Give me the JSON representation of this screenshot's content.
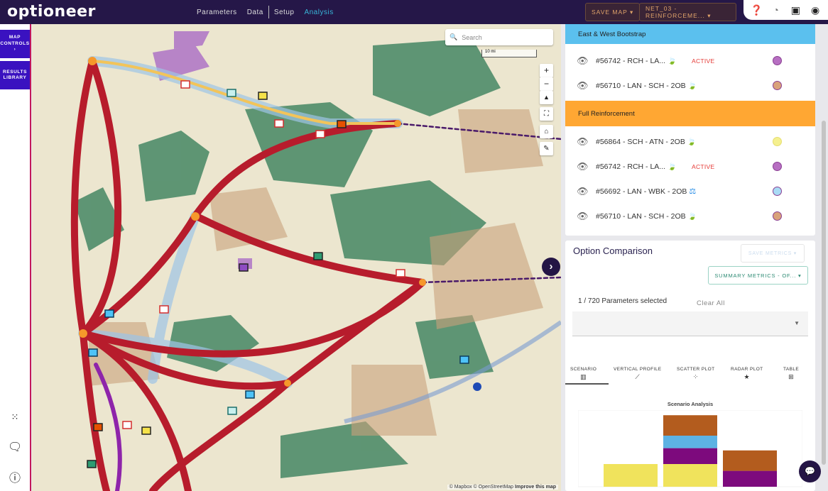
{
  "app": {
    "logo": "optioneer"
  },
  "nav": {
    "items": [
      {
        "label": "Parameters"
      },
      {
        "label": "Data"
      },
      {
        "label": "Setup"
      },
      {
        "label": "Analysis",
        "active": true
      }
    ]
  },
  "toolbar": {
    "save_map": "SAVE MAP ▾",
    "network": "NET_03 - REINFORCEME... ▾",
    "icons": [
      "help-icon",
      "speedometer-icon",
      "feedback-icon",
      "account-icon"
    ]
  },
  "sidebar": {
    "map_controls": "MAP CONTROLS ›",
    "results_library": "RESULTS LIBRARY",
    "icons": [
      "grid-dots-icon",
      "comment-icon",
      "info-icon"
    ]
  },
  "map": {
    "search_placeholder": "Search",
    "scale": "10 mi",
    "attribution": "© Mapbox © OpenStreetMap",
    "improve": "Improve this map"
  },
  "groups": [
    {
      "title": "East & West Bootstrap",
      "color": "#5bc0ee",
      "items": [
        {
          "label": "#56742 - RCH - LA...",
          "icon": "leaf",
          "status": "ACTIVE",
          "dot": "#b76fc2"
        },
        {
          "label": "#56710 - LAN - SCH - 2OB",
          "icon": "leaf",
          "status": "",
          "dot": "#d9a27a"
        }
      ]
    },
    {
      "title": "Full Reinforcement",
      "color": "#ffa733",
      "items": [
        {
          "label": "#56864 - SCH - ATN - 2OB",
          "icon": "leaf",
          "status": "",
          "dot": "#f5f08f"
        },
        {
          "label": "#56742 - RCH - LA...",
          "icon": "leaf",
          "status": "ACTIVE",
          "dot": "#b76fc2"
        },
        {
          "label": "#56692 - LAN - WBK - 2OB",
          "icon": "scale",
          "status": "",
          "dot": "#a9dbf5"
        },
        {
          "label": "#56710 - LAN - SCH - 2OB",
          "icon": "leaf",
          "status": "",
          "dot": "#d9a27a"
        }
      ]
    }
  ],
  "comparison": {
    "title": "Option Comparison",
    "save_metrics": "SAVE METRICS ▾",
    "summary_metrics": "SUMMARY METRICS - OF... ▾",
    "selected": "1 / 720 Parameters selected",
    "clear_all": "Clear All",
    "tabs": [
      {
        "label": "SCENARIO",
        "icon": "bar-chart-icon",
        "glyph": "▥",
        "active": true
      },
      {
        "label": "VERTICAL PROFILE",
        "icon": "line-chart-icon",
        "glyph": "⟋"
      },
      {
        "label": "SCATTER PLOT",
        "icon": "scatter-icon",
        "glyph": "⁘"
      },
      {
        "label": "RADAR PLOT",
        "icon": "star-icon",
        "glyph": "★"
      },
      {
        "label": "TABLE",
        "icon": "table-icon",
        "glyph": "⊞"
      }
    ]
  },
  "chart_data": {
    "type": "bar",
    "stacked": true,
    "title": "Scenario Analysis",
    "categories": [
      "",
      "",
      ""
    ],
    "series": [
      {
        "color": "#f0e35c",
        "values": [
          1.0,
          1.0,
          0
        ]
      },
      {
        "color": "#7d0a7d",
        "values": [
          0,
          0.7,
          0.7
        ]
      },
      {
        "color": "#5db2e3",
        "values": [
          0,
          0.55,
          0
        ]
      },
      {
        "color": "#b35c1e",
        "values": [
          0,
          0.9,
          0.9
        ]
      }
    ],
    "axes": "none",
    "grid": false
  }
}
